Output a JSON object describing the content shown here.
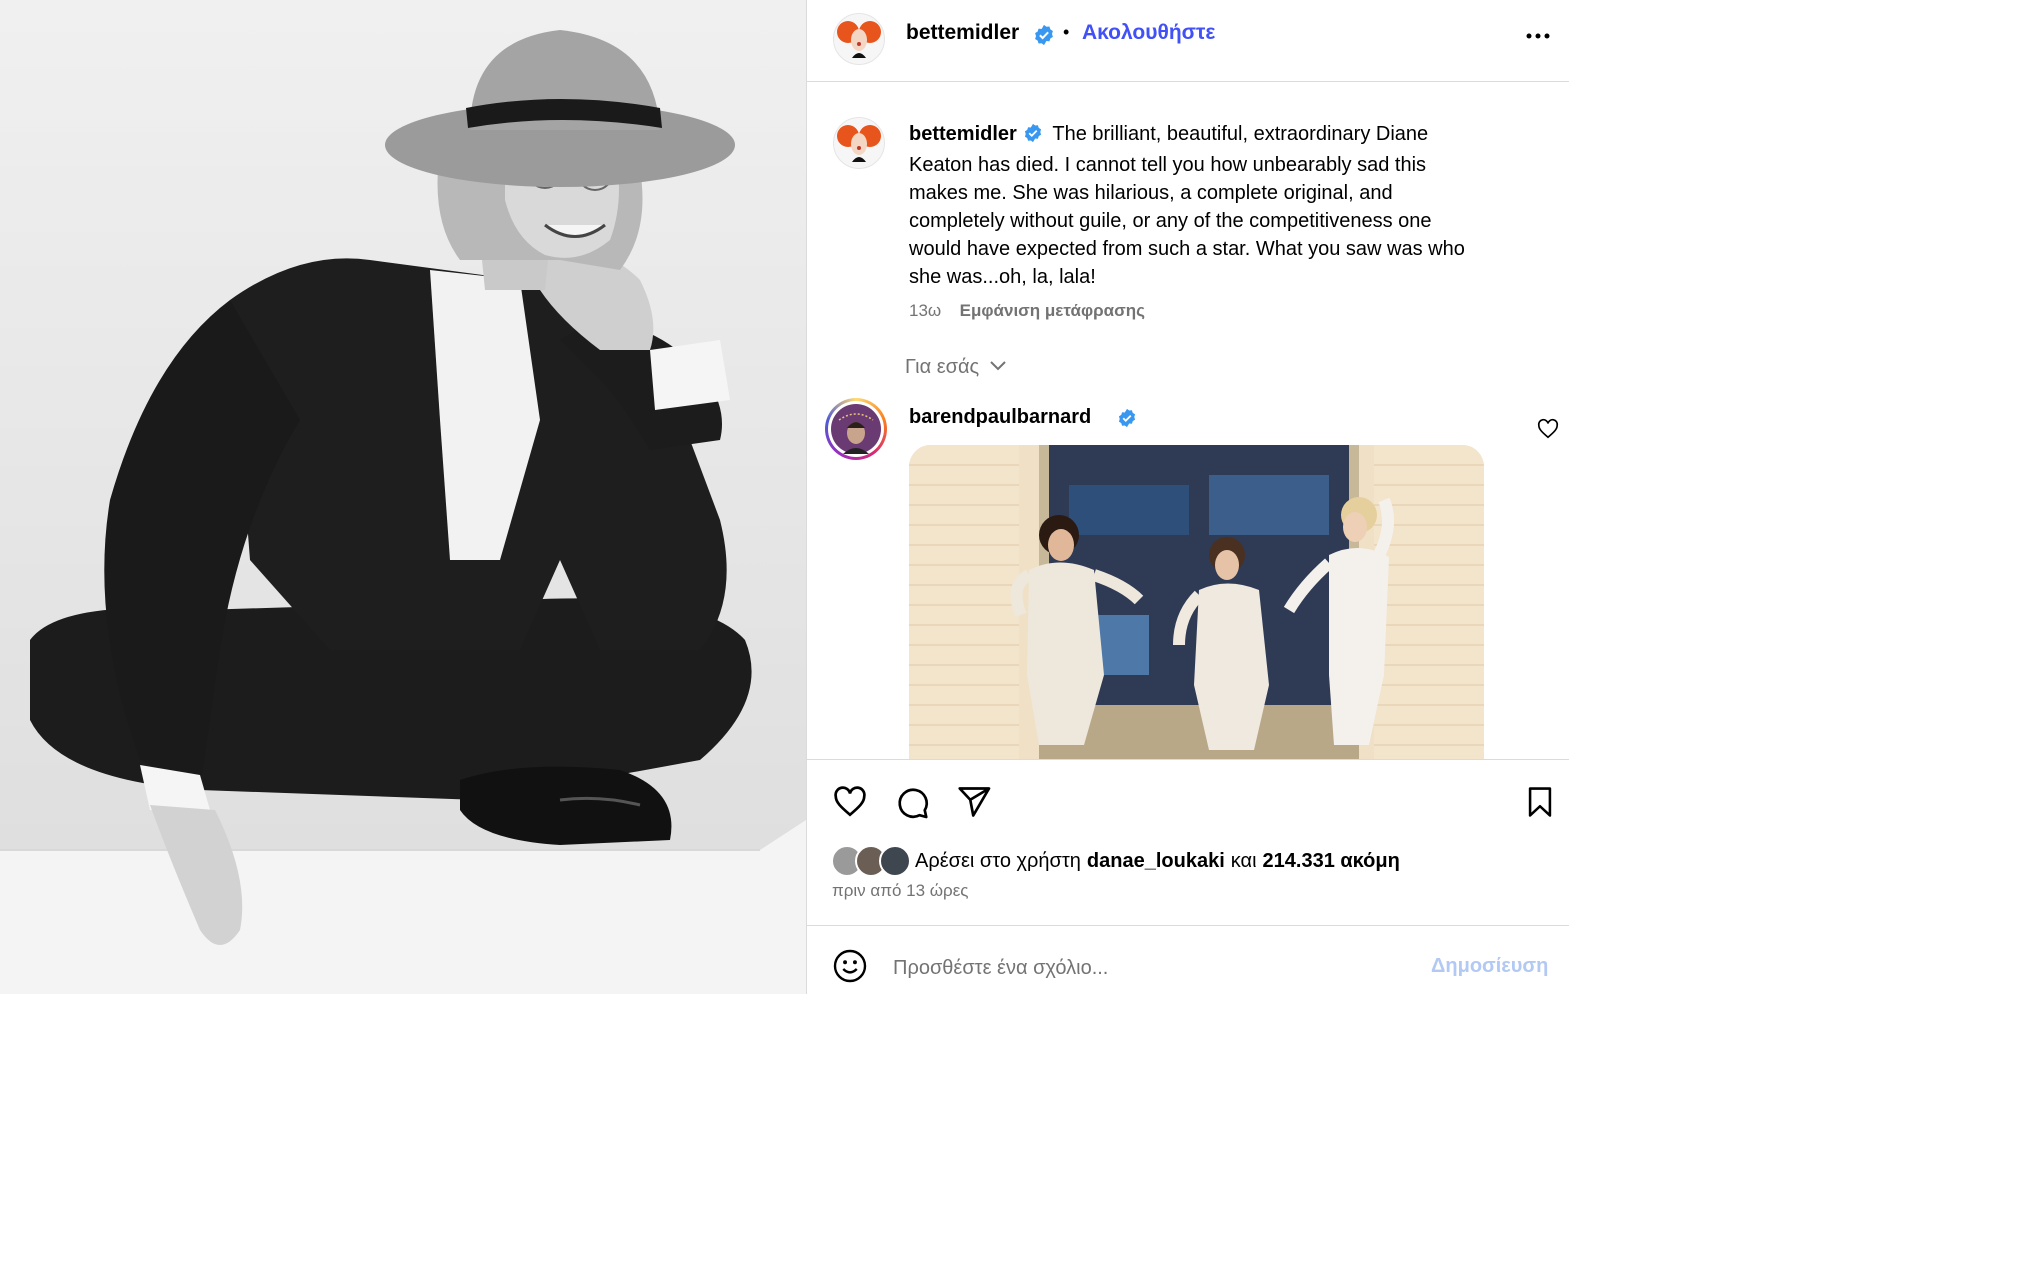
{
  "post_author": {
    "username": "bettemidler",
    "follow_label": "Ακολουθήστε",
    "dot": "•"
  },
  "caption": {
    "username": "bettemidler",
    "text": "The brilliant, beautiful, extraordinary Diane Keaton has died. I cannot tell you how unbearably sad this makes me. She was hilarious, a complete original, and completely without guile, or any of the competitiveness one would have expected from such a star. What you saw was who she was...oh, la, lala!",
    "lines": [
      "Keaton has died. I cannot tell you how unbearably sad this",
      "makes me. She was hilarious, a complete original, and",
      "completely without guile, or any of the competitiveness one",
      "would have expected from such a star. What you saw was who",
      "she was...oh, la, lala!"
    ],
    "first_line": "The brilliant, beautiful, extraordinary Diane",
    "time": "13ω",
    "translate_label": "Εμφάνιση μετάφρασης"
  },
  "for_you": {
    "label": "Για εσάς"
  },
  "comment": {
    "username": "barendpaulbarnard"
  },
  "likes": {
    "prefix": "Αρέσει στο χρήστη",
    "user": "danae_loukaki",
    "and": "και",
    "count": "214.331 ακόμη",
    "time": "πριν από 13 ώρες"
  },
  "add_comment": {
    "placeholder": "Προσθέστε ένα σχόλιο...",
    "post_label": "Δημοσίευση"
  },
  "colors": {
    "accent": "#4150f7",
    "verified": "#3897f0",
    "muted": "#737373",
    "post_disabled": "#b2c9f4"
  },
  "icons": [
    "verified-badge-icon",
    "more-options-icon",
    "chevron-down-icon",
    "heart-icon",
    "comment-icon",
    "share-icon",
    "bookmark-icon",
    "emoji-icon"
  ]
}
